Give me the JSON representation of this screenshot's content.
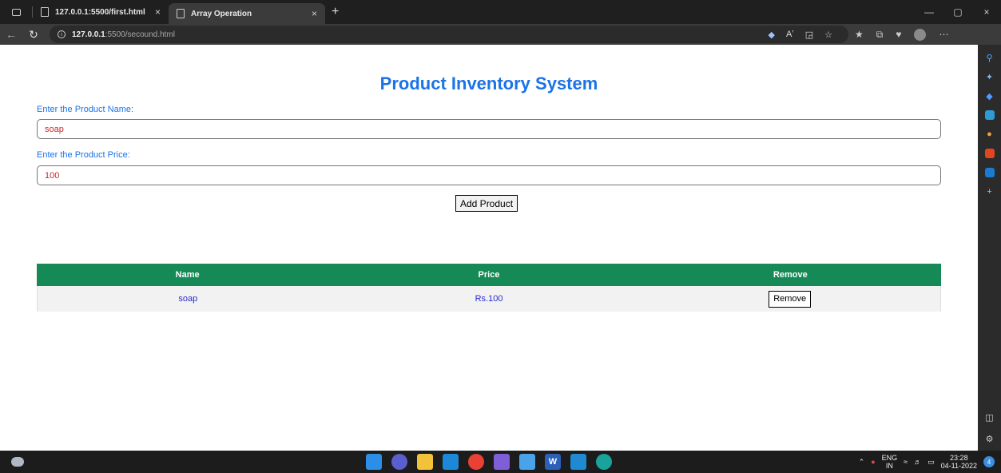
{
  "browser": {
    "tabs": [
      {
        "title": "127.0.0.1:5500/first.html",
        "close": "×"
      },
      {
        "title": "Array Operation",
        "close": "×"
      }
    ],
    "new_tab": "+",
    "url_host": "127.0.0.1",
    "url_path": ":5500/secound.html",
    "window_controls": {
      "minimize": "—",
      "restore": "▢",
      "close": "×"
    }
  },
  "page": {
    "heading": "Product Inventory System",
    "name_label": "Enter the Product Name:",
    "name_value": "soap",
    "price_label": "Enter the Product Price:",
    "price_value": "100",
    "add_button": "Add Product",
    "table": {
      "headers": [
        "Name",
        "Price",
        "Remove"
      ],
      "rows": [
        {
          "name": "soap",
          "price": "Rs.100",
          "action": "Remove"
        }
      ]
    }
  },
  "taskbar": {
    "language_top": "ENG",
    "language_bottom": "IN",
    "time": "23:28",
    "date": "04-11-2022",
    "notifications": "4"
  },
  "colors": {
    "heading": "#1a73e8",
    "table_header": "#168a56",
    "cell_text": "#2a2ad0",
    "input_text": "#c62828"
  }
}
